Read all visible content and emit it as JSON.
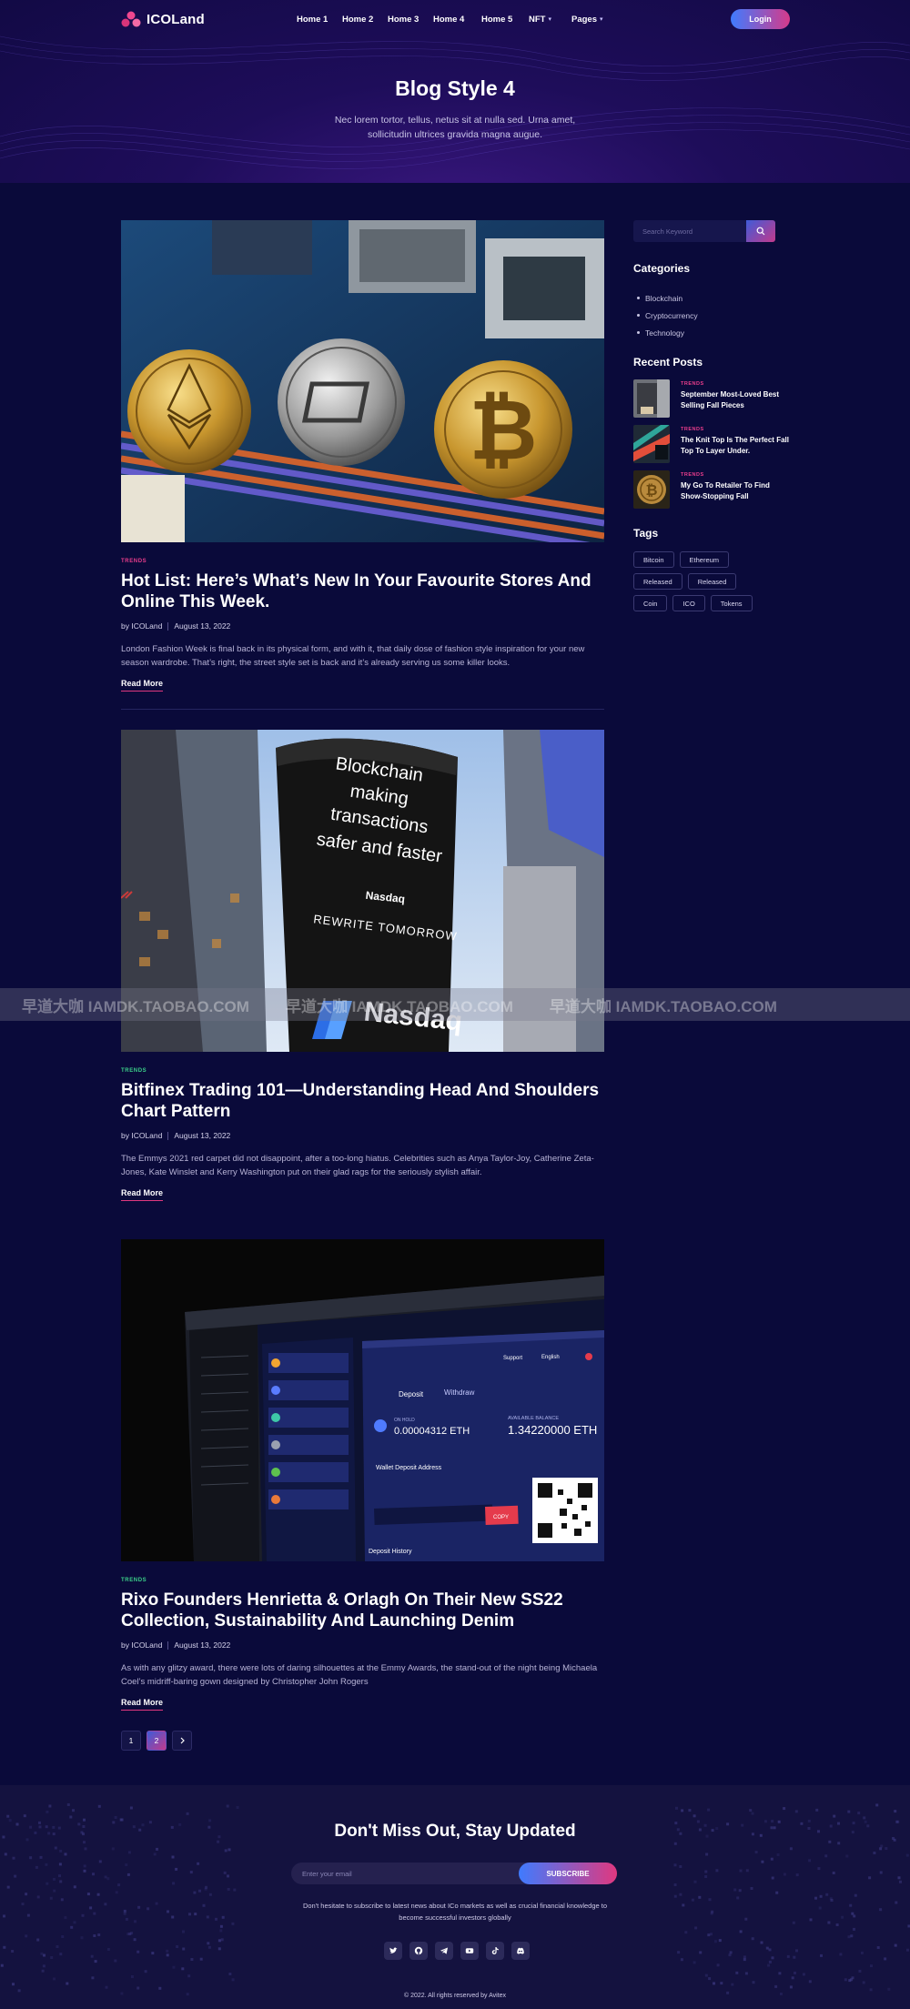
{
  "header": {
    "logo_text": "ICOLand",
    "menu": [
      {
        "label": "Home 1",
        "has_caret": false
      },
      {
        "label": "Home 2",
        "has_caret": false
      },
      {
        "label": "Home 3",
        "has_caret": false
      },
      {
        "label": "Home 4",
        "has_caret": false
      },
      {
        "label": "Home 5",
        "has_caret": false
      },
      {
        "label": "NFT",
        "has_caret": true
      },
      {
        "label": "Pages",
        "has_caret": true
      }
    ],
    "login_label": "Login"
  },
  "hero": {
    "title": "Blog Style 4",
    "subtitle": "Nec lorem tortor, tellus, netus sit at nulla sed. Urna amet, sollicitudin ultrices gravida magna augue."
  },
  "posts": [
    {
      "category": "TRENDS",
      "category_color": "#ea3d8c",
      "title": "Hot List: Here’s What’s New In Your Favourite Stores And Online This Week.",
      "author": "by ICOLand",
      "date": "August 13, 2022",
      "excerpt": "London Fashion Week is final back in its physical form, and with it, that daily dose of fashion style inspiration for your new season wardrobe. That’s right, the street style set is back and it’s already serving us some killer looks.",
      "read_more": "Read More",
      "image": "crypto-coins-motherboard"
    },
    {
      "category": "TRENDS",
      "category_color": "#3bd18a",
      "title": "Bitfinex Trading 101—Understanding Head And Shoulders Chart Pattern",
      "author": "by ICOLand",
      "date": "August 13, 2022",
      "excerpt": "The Emmys 2021 red carpet did not disappoint, after a too-long hiatus. Celebrities such as Anya Taylor-Joy, Catherine Zeta-Jones, Kate Winslet and Kerry Washington put on their glad rags for the seriously stylish affair.",
      "read_more": "Read More",
      "image": "nasdaq-tower",
      "image_text": {
        "line1": "Blockchain",
        "line2": "making",
        "line3": "transactions",
        "line4": "safer and faster",
        "brand_small": "Nasdaq",
        "tagline": "REWRITE TOMORROW",
        "brand_large": "Nasdaq"
      }
    },
    {
      "category": "TRENDS",
      "category_color": "#3bd18a",
      "title": "Rixo Founders Henrietta & Orlagh On Their New SS22 Collection, Sustainability And Launching Denim",
      "author": "by ICOLand",
      "date": "August 13, 2022",
      "excerpt": "As with any glitzy award, there were lots of daring silhouettes at the Emmy Awards, the stand-out of the night being Michaela Coel’s midriff-baring gown designed by Christopher John Rogers",
      "read_more": "Read More",
      "image": "crypto-wallet-screen",
      "image_text": {
        "tab1": "Deposit",
        "tab2": "Withdraw",
        "on_hold_label": "ON HOLD",
        "on_hold_value": "0.00004312 ETH",
        "balance_label": "AVAILABLE BALANCE",
        "balance_value": "1.34220000 ETH",
        "address_label": "Wallet Deposit Address",
        "copy": "COPY",
        "history": "Deposit History",
        "support": "Support",
        "language": "English"
      }
    }
  ],
  "pagination": {
    "pages": [
      "1",
      "2"
    ],
    "active": "2",
    "next_icon": "chevron-right-icon"
  },
  "sidebar": {
    "search_placeholder": "Search Keyword",
    "categories_title": "Categories",
    "categories": [
      "Blockchain",
      "Cryptocurrency",
      "Technology"
    ],
    "recent_title": "Recent Posts",
    "recent_posts": [
      {
        "category": "TRENDS",
        "title": "September Most-Loved Best Selling Fall Pieces"
      },
      {
        "category": "TRENDS",
        "title": "The Knit Top Is The Perfect Fall Top To Layer Under."
      },
      {
        "category": "TRENDS",
        "title": "My Go To Retailer To Find Show-Stopping Fall"
      }
    ],
    "tags_title": "Tags",
    "tags": [
      "Bitcoin",
      "Ethereum",
      "Released",
      "Released",
      "Coin",
      "ICO",
      "Tokens"
    ]
  },
  "watermark": [
    "早道大咖 IAMDK.TAOBAO.COM",
    "早道大咖 IAMDK.TAOBAO.COM",
    "早道大咖 IAMDK.TAOBAO.COM"
  ],
  "newsletter": {
    "title": "Don't Miss Out, Stay Updated",
    "email_placeholder": "Enter your email",
    "subscribe_label": "SUBSCRIBE",
    "text": "Don't hesitate to subscribe to latest news about ICo markets as well as crucial financial knowledge to become successful investors globally",
    "socials": [
      "twitter-icon",
      "github-icon",
      "telegram-icon",
      "youtube-icon",
      "tiktok-icon",
      "discord-icon"
    ]
  },
  "footer": {
    "copyright": "© 2022. All rights reserved by Avitex"
  },
  "colors": {
    "background": "#0a0a3a",
    "accent_pink": "#e0387f",
    "accent_blue": "#3f7bff",
    "trend_pink": "#ea3d8c",
    "trend_green": "#3bd18a"
  }
}
